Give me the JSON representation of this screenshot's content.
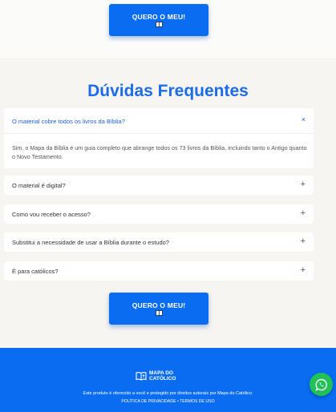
{
  "cta": {
    "label": "QUERO O MEU!",
    "icon": "book-icon"
  },
  "faq": {
    "title": "Dúvidas Frequentes",
    "items": [
      {
        "question": "O material cobre todos os livros da Bíblia?",
        "answer": "Sim, o Mapa da Bíblia é um guia completo que abrange todos os 73 livros da Bíblia, incluindo tanto o Antigo quanto o Novo Testamento.",
        "toggle": "×",
        "expanded": true
      },
      {
        "question": "O material é digital?",
        "toggle": "+",
        "expanded": false
      },
      {
        "question": "Como vou receber o acesso?",
        "toggle": "+",
        "expanded": false
      },
      {
        "question": "Substitui a necessidade de usar a Bíblia durante o estudo?",
        "toggle": "+",
        "expanded": false
      },
      {
        "question": "É para católicos?",
        "toggle": "+",
        "expanded": false
      }
    ]
  },
  "footer": {
    "logo_line1": "MAPA DO",
    "logo_line2": "CATÓLICO",
    "rights": "Este produto é oferecido a você e protegido por direitos autorais por Mapa do Católico.",
    "links": "POLÍTICA DE PRIVACIDADE • TERMOS DE USO"
  },
  "colors": {
    "accent": "#0a6cf1",
    "title": "#1d6ce8",
    "whatsapp": "#22c155"
  }
}
